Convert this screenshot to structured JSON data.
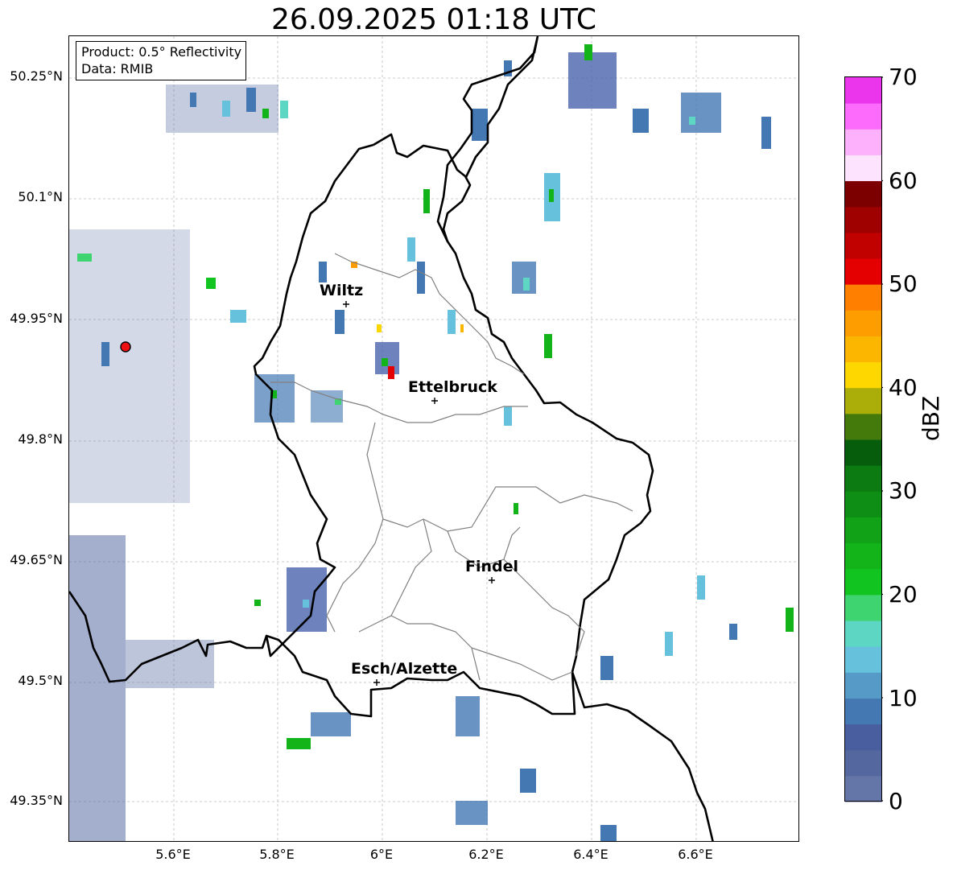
{
  "title": "26.09.2025 01:18 UTC",
  "info": {
    "product": "Product: 0.5° Reflectivity",
    "data": "Data: RMIB"
  },
  "lat_ticks": [
    "50.25°N",
    "50.1°N",
    "49.95°N",
    "49.8°N",
    "49.65°N",
    "49.5°N",
    "49.35°N"
  ],
  "lon_ticks": [
    "5.6°E",
    "5.8°E",
    "6°E",
    "6.2°E",
    "6.4°E",
    "6.6°E"
  ],
  "cities": [
    {
      "name": "Wiltz"
    },
    {
      "name": "Ettelbruck"
    },
    {
      "name": "Findel"
    },
    {
      "name": "Esch/Alzette"
    }
  ],
  "colorbar": {
    "label": "dBZ",
    "ticks": [
      "0",
      "10",
      "20",
      "30",
      "40",
      "50",
      "60",
      "70"
    ],
    "colors": [
      "#6475a8",
      "#55679f",
      "#485e9e",
      "#4378b3",
      "#569ac7",
      "#66c2dc",
      "#5ed6c4",
      "#3ed46f",
      "#12c41f",
      "#12b41a",
      "#11a218",
      "#0f8e15",
      "#0b7b12",
      "#065d0c",
      "#437a0b",
      "#abad08",
      "#ffd700",
      "#fdb600",
      "#fd9d00",
      "#ff7f00",
      "#e40000",
      "#c10000",
      "#9f0000",
      "#7d0000",
      "#fde3fe",
      "#fdb1fd",
      "#fd6bfd",
      "#ea35ec"
    ]
  },
  "radar_marker_color": "#ee1111"
}
